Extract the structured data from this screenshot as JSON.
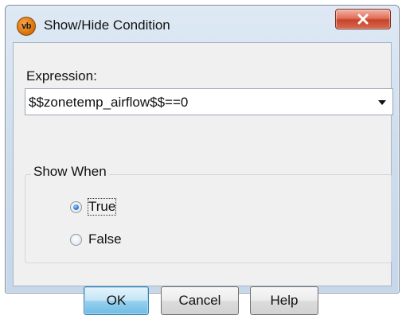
{
  "window": {
    "title": "Show/Hide Condition",
    "app_icon_text": "vb",
    "accent_color": "#e07a12",
    "close_icon": "close-x-icon"
  },
  "expression": {
    "label": "Expression:",
    "value": "$$zonetemp_airflow$$==0",
    "dropdown_icon": "chevron-down-icon"
  },
  "show_when": {
    "title": "Show When",
    "options": [
      {
        "label": "True",
        "checked": true
      },
      {
        "label": "False",
        "checked": false
      }
    ]
  },
  "buttons": {
    "ok": "OK",
    "cancel": "Cancel",
    "help": "Help"
  }
}
